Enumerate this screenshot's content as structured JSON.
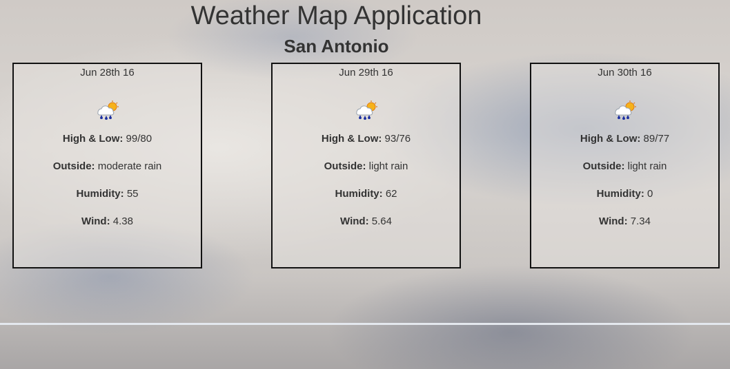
{
  "app": {
    "title": "Weather Map Application",
    "city": "San Antonio"
  },
  "forecast": [
    {
      "date": "Jun 28th 16",
      "icon": "rain-sun-icon",
      "high_low_label": "High & Low:",
      "high_low": "99/80",
      "outside_label": "Outside:",
      "outside": "moderate rain",
      "humidity_label": "Humidity:",
      "humidity": "55",
      "wind_label": "Wind:",
      "wind": "4.38"
    },
    {
      "date": "Jun 29th 16",
      "icon": "rain-sun-icon",
      "high_low_label": "High & Low:",
      "high_low": "93/76",
      "outside_label": "Outside:",
      "outside": "light rain",
      "humidity_label": "Humidity:",
      "humidity": "62",
      "wind_label": "Wind:",
      "wind": "5.64"
    },
    {
      "date": "Jun 30th 16",
      "icon": "rain-sun-icon",
      "high_low_label": "High & Low:",
      "high_low": "89/77",
      "outside_label": "Outside:",
      "outside": "light rain",
      "humidity_label": "Humidity:",
      "humidity": "0",
      "wind_label": "Wind:",
      "wind": "7.34"
    }
  ],
  "colors": {
    "text": "#333333",
    "card_border": "#111111",
    "divider": "#e4e8ee"
  }
}
